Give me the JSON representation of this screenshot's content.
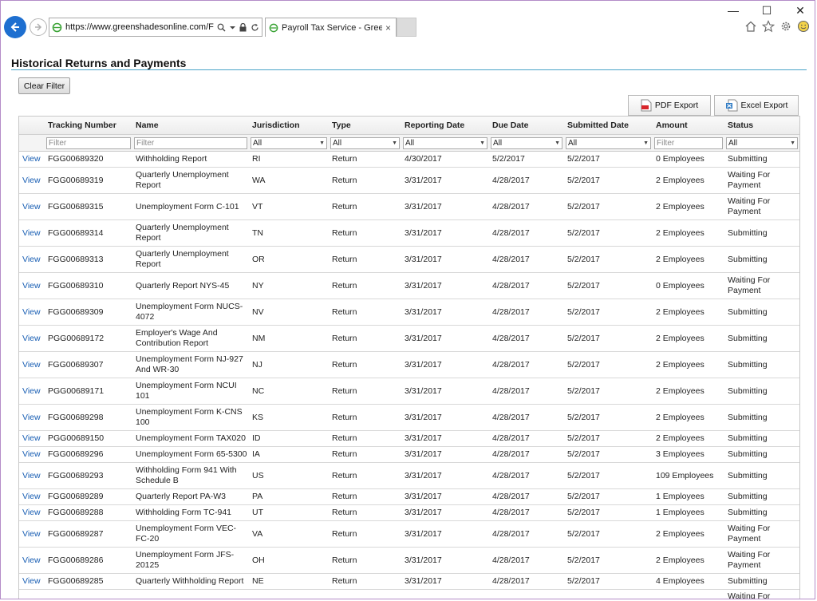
{
  "browser": {
    "url": "https://www.greenshadesonline.com/FileF",
    "tab_title": "Payroll Tax Service - Greens...",
    "tab_close": "×",
    "window_controls": [
      "—",
      "☐",
      "✕"
    ]
  },
  "page": {
    "title": "Historical Returns and Payments",
    "clear_filter": "Clear Filter",
    "pdf_export": "PDF Export",
    "excel_export": "Excel Export"
  },
  "table": {
    "columns": [
      "",
      "Tracking Number",
      "Name",
      "Jurisdiction",
      "Type",
      "Reporting Date",
      "Due Date",
      "Submitted Date",
      "Amount",
      "Status"
    ],
    "filters": {
      "tracking_placeholder": "Filter",
      "name_placeholder": "Filter",
      "jurisdiction": "All",
      "type": "All",
      "reporting_date": "All",
      "due_date": "All",
      "submitted_date": "All",
      "amount_placeholder": "Filter",
      "status": "All"
    },
    "rows": [
      {
        "view": "View",
        "tracking": "FGG00689320",
        "name": "Withholding Report",
        "jur": "RI",
        "type": "Return",
        "rep": "4/30/2017",
        "due": "5/2/2017",
        "sub": "5/2/2017",
        "amount": "0 Employees",
        "status": "Submitting"
      },
      {
        "view": "View",
        "tracking": "FGG00689319",
        "name": "Quarterly Unemployment Report",
        "jur": "WA",
        "type": "Return",
        "rep": "3/31/2017",
        "due": "4/28/2017",
        "sub": "5/2/2017",
        "amount": "2 Employees",
        "status": "Waiting For Payment"
      },
      {
        "view": "View",
        "tracking": "FGG00689315",
        "name": "Unemployment Form C-101",
        "jur": "VT",
        "type": "Return",
        "rep": "3/31/2017",
        "due": "4/28/2017",
        "sub": "5/2/2017",
        "amount": "2 Employees",
        "status": "Waiting For Payment"
      },
      {
        "view": "View",
        "tracking": "FGG00689314",
        "name": "Quarterly Unemployment Report",
        "jur": "TN",
        "type": "Return",
        "rep": "3/31/2017",
        "due": "4/28/2017",
        "sub": "5/2/2017",
        "amount": "2 Employees",
        "status": "Submitting"
      },
      {
        "view": "View",
        "tracking": "FGG00689313",
        "name": "Quarterly Unemployment Report",
        "jur": "OR",
        "type": "Return",
        "rep": "3/31/2017",
        "due": "4/28/2017",
        "sub": "5/2/2017",
        "amount": "2 Employees",
        "status": "Submitting"
      },
      {
        "view": "View",
        "tracking": "FGG00689310",
        "name": "Quarterly Report NYS-45",
        "jur": "NY",
        "type": "Return",
        "rep": "3/31/2017",
        "due": "4/28/2017",
        "sub": "5/2/2017",
        "amount": "0 Employees",
        "status": "Waiting For Payment"
      },
      {
        "view": "View",
        "tracking": "FGG00689309",
        "name": "Unemployment Form NUCS-4072",
        "jur": "NV",
        "type": "Return",
        "rep": "3/31/2017",
        "due": "4/28/2017",
        "sub": "5/2/2017",
        "amount": "2 Employees",
        "status": "Submitting"
      },
      {
        "view": "View",
        "tracking": "PGG00689172",
        "name": "Employer's Wage And Contribution Report",
        "jur": "NM",
        "type": "Return",
        "rep": "3/31/2017",
        "due": "4/28/2017",
        "sub": "5/2/2017",
        "amount": "2 Employees",
        "status": "Submitting"
      },
      {
        "view": "View",
        "tracking": "FGG00689307",
        "name": "Unemployment Form NJ-927 And WR-30",
        "jur": "NJ",
        "type": "Return",
        "rep": "3/31/2017",
        "due": "4/28/2017",
        "sub": "5/2/2017",
        "amount": "2 Employees",
        "status": "Submitting"
      },
      {
        "view": "View",
        "tracking": "PGG00689171",
        "name": "Unemployment Form NCUI 101",
        "jur": "NC",
        "type": "Return",
        "rep": "3/31/2017",
        "due": "4/28/2017",
        "sub": "5/2/2017",
        "amount": "2 Employees",
        "status": "Submitting"
      },
      {
        "view": "View",
        "tracking": "FGG00689298",
        "name": "Unemployment Form K-CNS 100",
        "jur": "KS",
        "type": "Return",
        "rep": "3/31/2017",
        "due": "4/28/2017",
        "sub": "5/2/2017",
        "amount": "2 Employees",
        "status": "Submitting"
      },
      {
        "view": "View",
        "tracking": "PGG00689150",
        "name": "Unemployment Form TAX020",
        "jur": "ID",
        "type": "Return",
        "rep": "3/31/2017",
        "due": "4/28/2017",
        "sub": "5/2/2017",
        "amount": "2 Employees",
        "status": "Submitting"
      },
      {
        "view": "View",
        "tracking": "FGG00689296",
        "name": "Unemployment Form 65-5300",
        "jur": "IA",
        "type": "Return",
        "rep": "3/31/2017",
        "due": "4/28/2017",
        "sub": "5/2/2017",
        "amount": "3 Employees",
        "status": "Submitting"
      },
      {
        "view": "View",
        "tracking": "FGG00689293",
        "name": "Withholding Form 941 With Schedule B",
        "jur": "US",
        "type": "Return",
        "rep": "3/31/2017",
        "due": "4/28/2017",
        "sub": "5/2/2017",
        "amount": "109 Employees",
        "status": "Submitting"
      },
      {
        "view": "View",
        "tracking": "FGG00689289",
        "name": "Quarterly Report PA-W3",
        "jur": "PA",
        "type": "Return",
        "rep": "3/31/2017",
        "due": "4/28/2017",
        "sub": "5/2/2017",
        "amount": "1 Employees",
        "status": "Submitting"
      },
      {
        "view": "View",
        "tracking": "FGG00689288",
        "name": "Withholding Form TC-941",
        "jur": "UT",
        "type": "Return",
        "rep": "3/31/2017",
        "due": "4/28/2017",
        "sub": "5/2/2017",
        "amount": "1 Employees",
        "status": "Submitting"
      },
      {
        "view": "View",
        "tracking": "FGG00689287",
        "name": "Unemployment Form VEC-FC-20",
        "jur": "VA",
        "type": "Return",
        "rep": "3/31/2017",
        "due": "4/28/2017",
        "sub": "5/2/2017",
        "amount": "2 Employees",
        "status": "Waiting For Payment"
      },
      {
        "view": "View",
        "tracking": "FGG00689286",
        "name": "Unemployment Form JFS-20125",
        "jur": "OH",
        "type": "Return",
        "rep": "3/31/2017",
        "due": "4/28/2017",
        "sub": "5/2/2017",
        "amount": "2 Employees",
        "status": "Waiting For Payment"
      },
      {
        "view": "View",
        "tracking": "FGG00689285",
        "name": "Quarterly Withholding Report",
        "jur": "NE",
        "type": "Return",
        "rep": "3/31/2017",
        "due": "4/28/2017",
        "sub": "5/2/2017",
        "amount": "4 Employees",
        "status": "Submitting"
      }
    ],
    "partial_row_status": "Waiting For"
  },
  "colors": {
    "link": "#1a5fb4",
    "accent_rule": "#4aa3c8",
    "back_button": "#1e6fd0",
    "frame": "#b48cc8"
  }
}
